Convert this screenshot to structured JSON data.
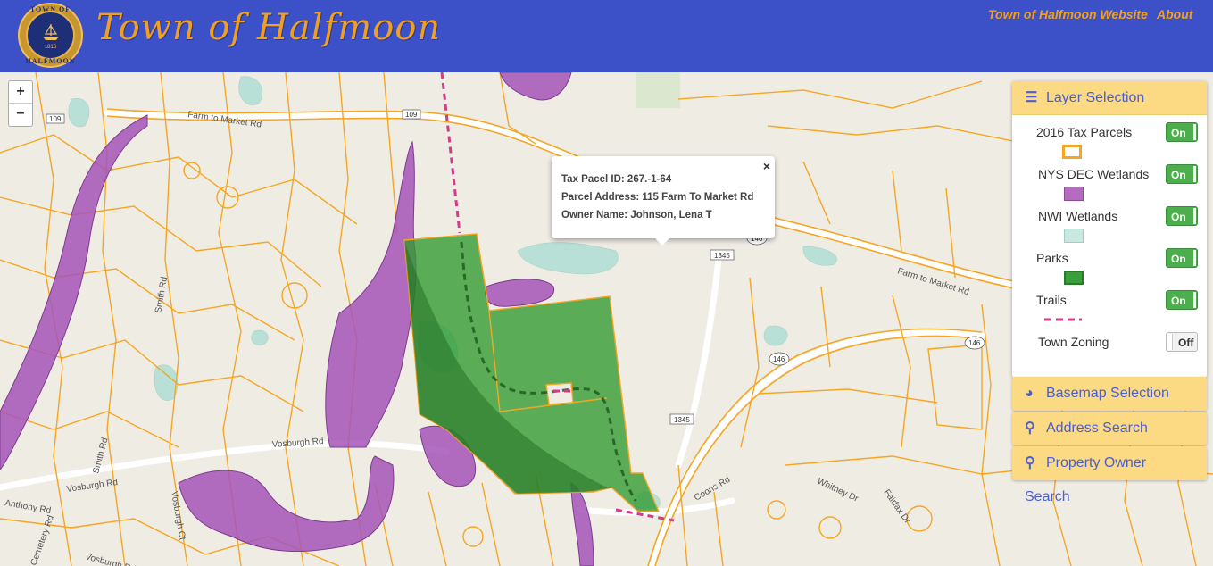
{
  "header": {
    "title": "Town of Halfmoon",
    "seal_top": "TOWN OF",
    "seal_bottom": "HALFMOON",
    "seal_year": "1816",
    "nav": [
      "Town of Halfmoon Website",
      "About"
    ]
  },
  "zoom": {
    "in": "+",
    "out": "−"
  },
  "popup": {
    "close": "×",
    "tax_id": "Tax Pacel ID: 267.-1-64",
    "address": "Parcel Address: 115 Farm To Market Rd",
    "owner": "Owner Name: Johnson, Lena T"
  },
  "panel": {
    "title": "Layer Selection",
    "layers": [
      {
        "label": "2016 Tax Parcels",
        "state": "On",
        "color": "#f5a623"
      },
      {
        "label": "NYS DEC Wetlands",
        "state": "On",
        "color": "#b56cc0"
      },
      {
        "label": "NWI Wetlands",
        "state": "On",
        "color": "#b8e0d6"
      },
      {
        "label": "Parks",
        "state": "On",
        "color": "#3a9e3a"
      },
      {
        "label": "Trails",
        "state": "On",
        "color": "#d23c8a"
      },
      {
        "label": "Town Zoning",
        "state": "Off",
        "color": ""
      }
    ],
    "sections": [
      "Basemap Selection",
      "Address Search",
      "Property Owner Search"
    ]
  },
  "map_labels": {
    "roads": [
      "Farm to Market Rd",
      "Farm to Market Rd",
      "Vosburgh Rd",
      "Vosburgh Rd",
      "Vosburgh Ct",
      "Smith Rd",
      "Smith Rd",
      "Anthony Rd",
      "Cemetery Rd",
      "Coons Rd",
      "Whitney Dr",
      "Fairfax Dr",
      "Vosburgh Rd"
    ],
    "shields": [
      "109",
      "109",
      "1345",
      "1345",
      "146",
      "146",
      "146"
    ]
  },
  "colors": {
    "header": "#3c50c8",
    "accent": "#f0a020",
    "parcel": "#f5a623",
    "wetland": "#b56cc0",
    "park": "#3a9e3a",
    "trail": "#d23c8a"
  }
}
